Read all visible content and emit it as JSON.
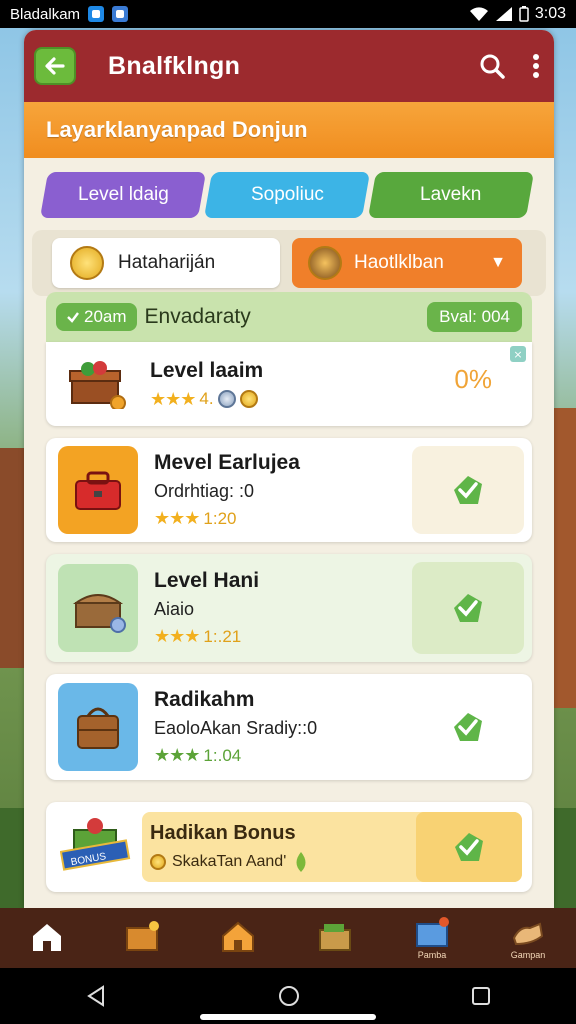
{
  "status_bar": {
    "title": "Bladalkam",
    "time": "3:03"
  },
  "app_bar": {
    "title": "Bnalfklngn"
  },
  "banner": {
    "title": "Layarklanyanpad Donjun"
  },
  "tabs": [
    {
      "label": "Level ldaig"
    },
    {
      "label": "Sopoliuc"
    },
    {
      "label": "Lavekn"
    }
  ],
  "filters": {
    "left_label": "Hatahariján",
    "right_label": "Haotlklban"
  },
  "list": {
    "header_pill": "20am",
    "header_title": "Envadaraty",
    "header_badge": "Bval: 004",
    "items": [
      {
        "name": "Level laaim",
        "sub": "",
        "rating": "4.",
        "percent": "0%",
        "stars": "★★★"
      },
      {
        "name": "Mevel Earlujea",
        "sub": "Ordrhtiag: :0",
        "rating": "1:20",
        "stars": "★★★"
      },
      {
        "name": "Level Hani",
        "sub": "Aiaio",
        "rating": "1:.21",
        "stars": "★★★"
      },
      {
        "name": "Radikahm",
        "sub": "EaoloAkan Sradiy::0",
        "rating": "1:.04",
        "stars": "★★★"
      }
    ],
    "bonus": {
      "name": "Hadikan Bonus",
      "sub": "SkakaTan Aand'",
      "badge": "BONUS"
    }
  },
  "bottom_nav": [
    {
      "label": "",
      "icon": "home-icon"
    },
    {
      "label": "",
      "icon": "chest-icon"
    },
    {
      "label": "",
      "icon": "house-icon"
    },
    {
      "label": "",
      "icon": "crate-icon"
    },
    {
      "label": "Pamba",
      "icon": "box-icon"
    },
    {
      "label": "Gampan",
      "icon": "hand-icon"
    }
  ]
}
